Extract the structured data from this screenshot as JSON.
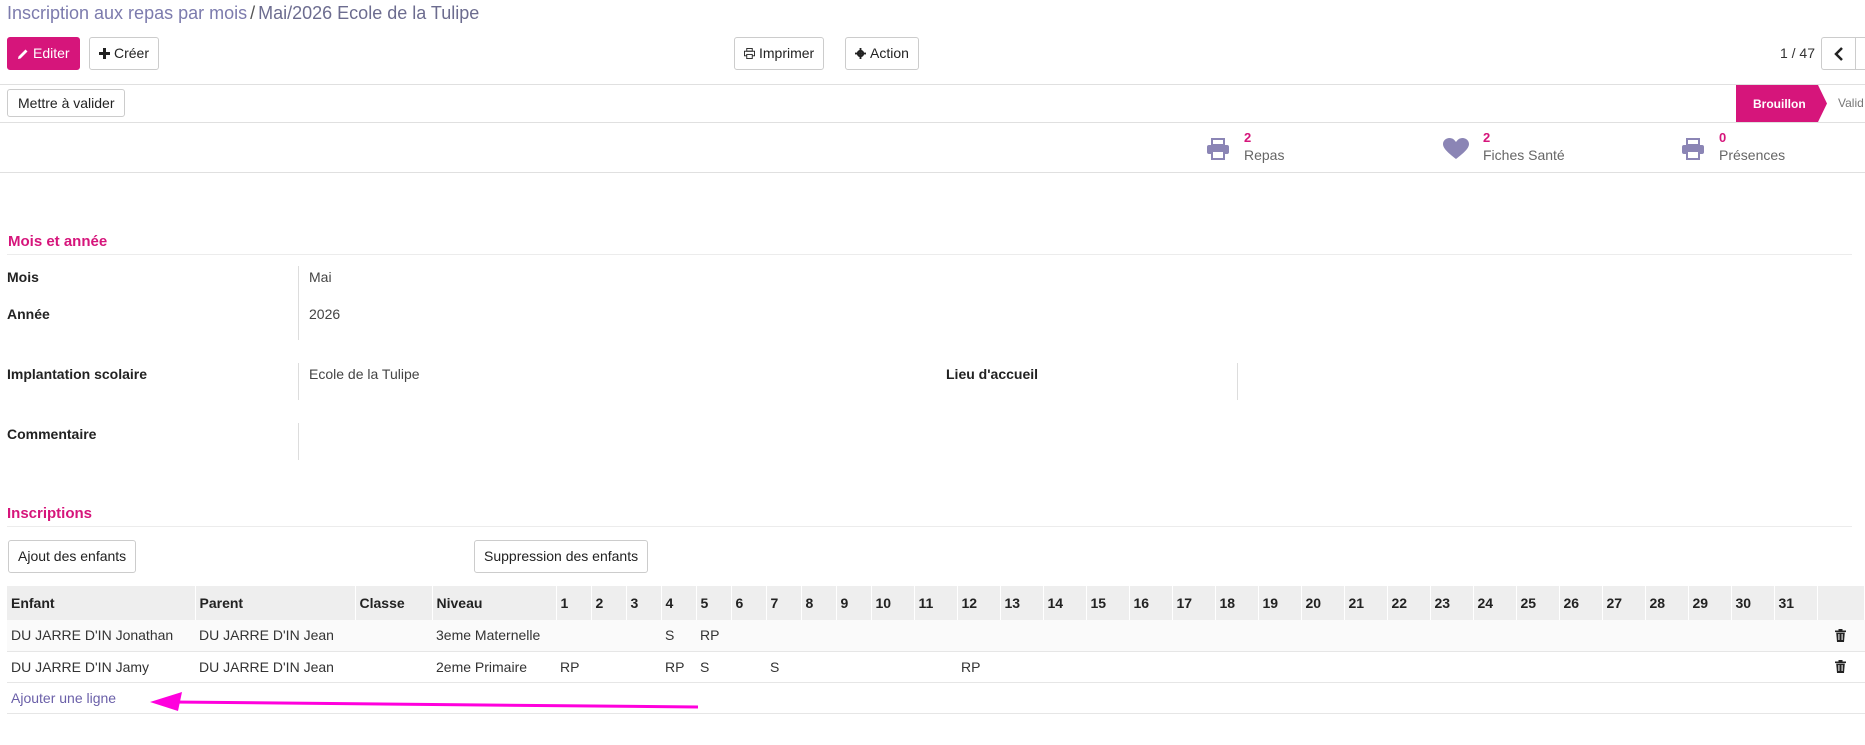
{
  "breadcrumb": {
    "parent": "Inscription aux repas par mois",
    "separator": "/",
    "current": "Mai/2026 Ecole de la Tulipe"
  },
  "toolbar": {
    "edit": "Editer",
    "create": "Créer",
    "print": "Imprimer",
    "action": "Action",
    "pager": "1 / 47"
  },
  "statusbar": {
    "validate_button": "Mettre à valider",
    "active": "Brouillon",
    "next": "Valid"
  },
  "stats": [
    {
      "value": "2",
      "label": "Repas",
      "icon": "printer-icon"
    },
    {
      "value": "2",
      "label": "Fiches Santé",
      "icon": "heart-icon"
    },
    {
      "value": "0",
      "label": "Présences",
      "icon": "printer-icon"
    }
  ],
  "section1": {
    "title": "Mois et année"
  },
  "fields": {
    "mois_label": "Mois",
    "mois_value": "Mai",
    "annee_label": "Année",
    "annee_value": "2026",
    "implantation_label": "Implantation scolaire",
    "implantation_value": "Ecole de la Tulipe",
    "lieu_label": "Lieu d'accueil",
    "lieu_value": "",
    "commentaire_label": "Commentaire",
    "commentaire_value": ""
  },
  "section2": {
    "title": "Inscriptions",
    "add_children": "Ajout des enfants",
    "remove_children": "Suppression des enfants"
  },
  "table": {
    "headers": [
      "Enfant",
      "Parent",
      "Classe",
      "Niveau",
      "1",
      "2",
      "3",
      "4",
      "5",
      "6",
      "7",
      "8",
      "9",
      "10",
      "11",
      "12",
      "13",
      "14",
      "15",
      "16",
      "17",
      "18",
      "19",
      "20",
      "21",
      "22",
      "23",
      "24",
      "25",
      "26",
      "27",
      "28",
      "29",
      "30",
      "31"
    ],
    "rows": [
      {
        "enfant": "DU JARRE D'IN Jonathan",
        "parent": "DU JARRE D'IN Jean",
        "classe": "",
        "niveau": "3eme Maternelle",
        "days": [
          "",
          "",
          "",
          "S",
          "RP",
          "",
          "",
          "",
          "",
          "",
          "",
          "",
          "",
          "",
          "",
          "",
          "",
          "",
          "",
          "",
          "",
          "",
          "",
          "",
          "",
          "",
          "",
          "",
          "",
          "",
          ""
        ]
      },
      {
        "enfant": "DU JARRE D'IN Jamy",
        "parent": "DU JARRE D'IN Jean",
        "classe": "",
        "niveau": "2eme Primaire",
        "days": [
          "RP",
          "",
          "",
          "RP",
          "S",
          "",
          "S",
          "",
          "",
          "",
          "",
          "RP",
          "",
          "",
          "",
          "",
          "",
          "",
          "",
          "",
          "",
          "",
          "",
          "",
          "",
          "",
          "",
          "",
          "",
          "",
          ""
        ]
      }
    ],
    "add_line": "Ajouter une ligne"
  },
  "colors": {
    "accent": "#d6157b",
    "link": "#6a5fa8",
    "icon": "#8b85b5",
    "arrow": "#ff00dd"
  }
}
